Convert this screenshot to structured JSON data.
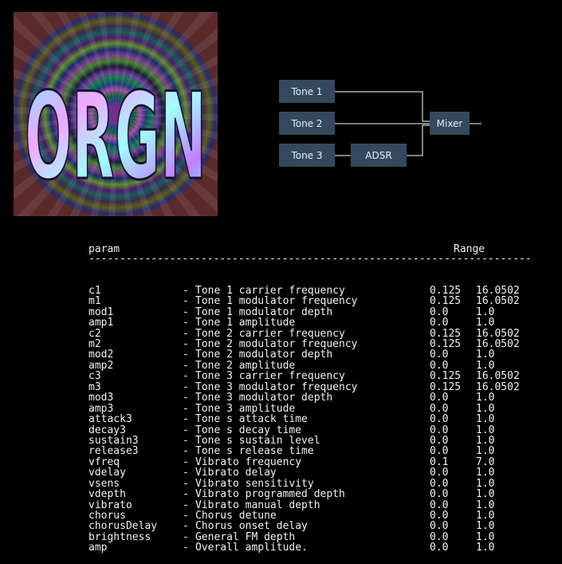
{
  "logo": {
    "text": "ORGN"
  },
  "diagram": {
    "nodes": {
      "tone1": "Tone 1",
      "tone2": "Tone 2",
      "tone3": "Tone 3",
      "adsr": "ADSR",
      "mixer": "Mixer"
    },
    "colors": {
      "node_bg": "#34495e",
      "line": "#ffffff"
    }
  },
  "table": {
    "headers": {
      "param": "param",
      "range": "Range"
    },
    "rule": "------------------------------------------------------------------------------------------------------------------------------------------------------------------",
    "rows": [
      {
        "name": "c1",
        "desc": "Tone 1 carrier frequency",
        "min": "0.125",
        "max": "16.0502"
      },
      {
        "name": "m1",
        "desc": "Tone 1 modulator frequency",
        "min": "0.125",
        "max": "16.0502"
      },
      {
        "name": "mod1",
        "desc": "Tone 1 modulator depth",
        "min": "0.0",
        "max": "1.0"
      },
      {
        "name": "amp1",
        "desc": "Tone 1 amplitude",
        "min": "0.0",
        "max": "1.0"
      },
      {
        "name": "c2",
        "desc": "Tone 2 carrier frequency",
        "min": "0.125",
        "max": "16.0502"
      },
      {
        "name": "m2",
        "desc": "Tone 2 modulator frequency",
        "min": "0.125",
        "max": "16.0502"
      },
      {
        "name": "mod2",
        "desc": "Tone 2 modulator depth",
        "min": "0.0",
        "max": "1.0"
      },
      {
        "name": "amp2",
        "desc": "Tone 2 amplitude",
        "min": "0.0",
        "max": "1.0"
      },
      {
        "name": "c3",
        "desc": "Tone 3 carrier frequency",
        "min": "0.125",
        "max": "16.0502"
      },
      {
        "name": "m3",
        "desc": "Tone 3 modulator frequency",
        "min": "0.125",
        "max": "16.0502"
      },
      {
        "name": "mod3",
        "desc": "Tone 3 modulator depth",
        "min": "0.0",
        "max": "1.0"
      },
      {
        "name": "amp3",
        "desc": "Tone 3 amplitude",
        "min": "0.0",
        "max": "1.0"
      },
      {
        "name": "attack3",
        "desc": "Tone s attack time",
        "min": "0.0",
        "max": "1.0"
      },
      {
        "name": "decay3",
        "desc": "Tone s decay time",
        "min": "0.0",
        "max": "1.0"
      },
      {
        "name": "sustain3",
        "desc": "Tone s sustain level",
        "min": "0.0",
        "max": "1.0"
      },
      {
        "name": "release3",
        "desc": "Tone s release time",
        "min": "0.0",
        "max": "1.0"
      },
      {
        "name": "vfreq",
        "desc": "Vibrato frequency",
        "min": "0.1",
        "max": "7.0"
      },
      {
        "name": "vdelay",
        "desc": "Vibrato delay",
        "min": "0.0",
        "max": "1.0"
      },
      {
        "name": "vsens",
        "desc": "Vibrato sensitivity",
        "min": "0.0",
        "max": "1.0"
      },
      {
        "name": "vdepth",
        "desc": "Vibrato programmed depth",
        "min": "0.0",
        "max": "1.0"
      },
      {
        "name": "vibrato",
        "desc": "Vibrato manual depth",
        "min": "0.0",
        "max": "1.0"
      },
      {
        "name": "chorus",
        "desc": "Chorus detune",
        "min": "0.0",
        "max": "1.0"
      },
      {
        "name": "chorusDelay",
        "desc": "Chorus onset delay",
        "min": "0.0",
        "max": "1.0"
      },
      {
        "name": "brightness",
        "desc": "General FM depth",
        "min": "0.0",
        "max": "1.0"
      },
      {
        "name": "amp",
        "desc": "Overall amplitude.",
        "min": "0.0",
        "max": "1.0"
      }
    ]
  }
}
